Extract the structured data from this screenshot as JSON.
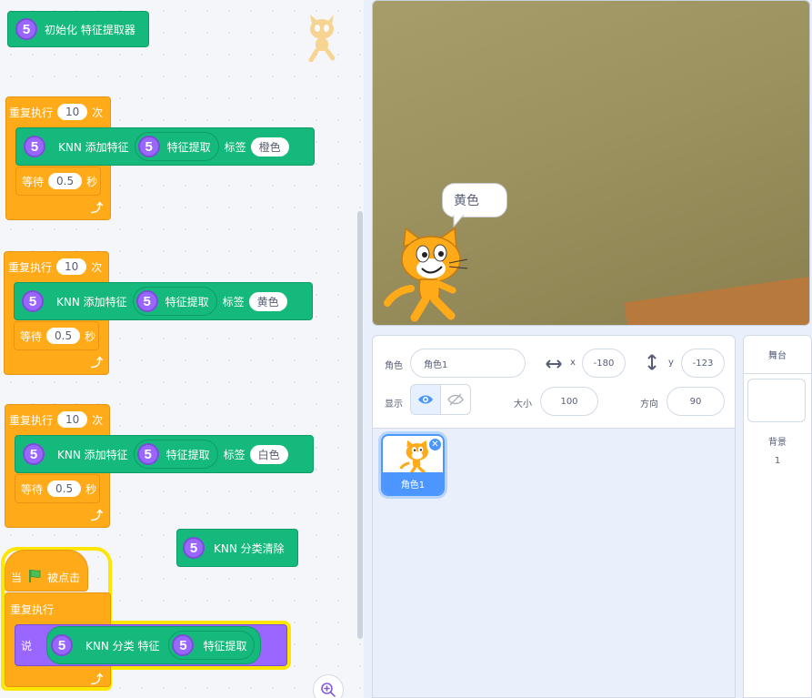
{
  "code": {
    "init_block": {
      "number": "5",
      "label": "初始化 特征提取器"
    },
    "loops": [
      {
        "label": "重复执行",
        "count": "10",
        "suffix": "次",
        "knn_num": "5",
        "knn_label": "KNN 添加特征",
        "feat_num": "5",
        "feat_label": "特征提取",
        "tag_label": "标签",
        "tag_value": "橙色",
        "wait_label": "等待",
        "wait_value": "0.5",
        "wait_unit": "秒"
      },
      {
        "label": "重复执行",
        "count": "10",
        "suffix": "次",
        "knn_num": "5",
        "knn_label": "KNN 添加特征",
        "feat_num": "5",
        "feat_label": "特征提取",
        "tag_label": "标签",
        "tag_value": "黄色",
        "wait_label": "等待",
        "wait_value": "0.5",
        "wait_unit": "秒"
      },
      {
        "label": "重复执行",
        "count": "10",
        "suffix": "次",
        "knn_num": "5",
        "knn_label": "KNN 添加特征",
        "feat_num": "5",
        "feat_label": "特征提取",
        "tag_label": "标签",
        "tag_value": "白色",
        "wait_label": "等待",
        "wait_value": "0.5",
        "wait_unit": "秒"
      }
    ],
    "clear_block": {
      "number": "5",
      "label": "KNN 分类清除"
    },
    "hat": {
      "when": "当",
      "clicked": "被点击"
    },
    "forever": {
      "label": "重复执行"
    },
    "say": {
      "label": "说",
      "knn_num": "5",
      "knn_label": "KNN 分类 特征",
      "feat_num": "5",
      "feat_label": "特征提取"
    }
  },
  "stage": {
    "speech": "黄色"
  },
  "sprite_info": {
    "sprite_label": "角色",
    "sprite_name": "角色1",
    "x_label": "x",
    "x_value": "-180",
    "y_label": "y",
    "y_value": "-123",
    "show_label": "显示",
    "size_label": "大小",
    "size_value": "100",
    "direction_label": "方向",
    "direction_value": "90"
  },
  "sprite_list": [
    {
      "name": "角色1"
    }
  ],
  "stage_selector": {
    "header": "舞台",
    "backdrops_label": "背景",
    "backdrops_count": "1"
  },
  "colors": {
    "teal": "#14b97b",
    "orange": "#ffab19",
    "purple": "#9966ff",
    "blue": "#4c97ff",
    "highlight": "#ffe600"
  }
}
